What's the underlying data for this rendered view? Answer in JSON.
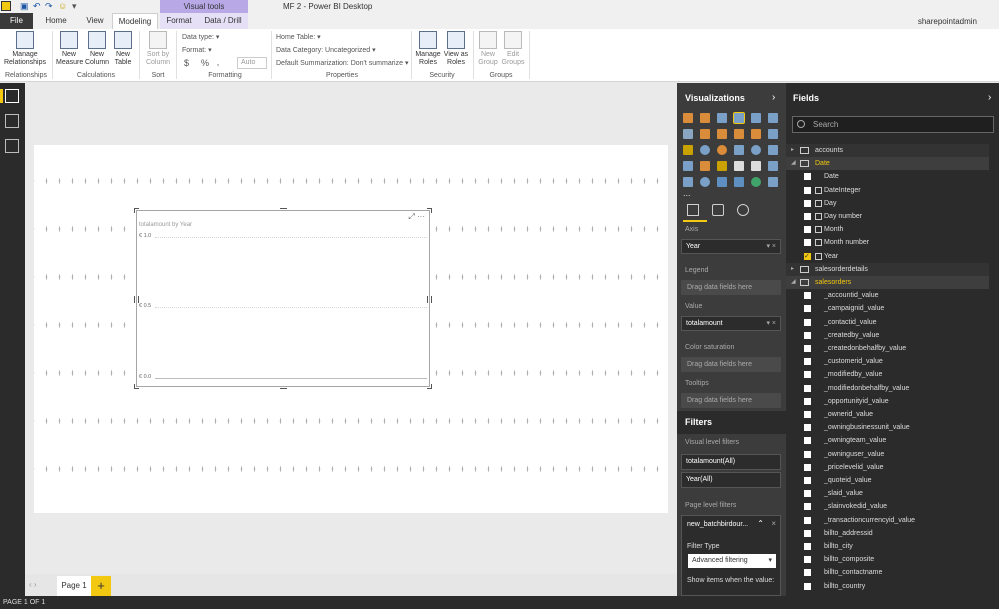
{
  "window": {
    "title": "MF 2 - Power BI Desktop",
    "context_tab_group": "Visual tools",
    "user": "sharepointadmin"
  },
  "tabs": {
    "file": "File",
    "home": "Home",
    "view": "View",
    "modeling": "Modeling",
    "format": "Format",
    "data_drill": "Data / Drill"
  },
  "ribbon": {
    "manage_relationships": "Manage\nRelationships",
    "new_measure": "New\nMeasure",
    "new_column": "New\nColumn",
    "new_table": "New\nTable",
    "sort_by_column": "Sort by\nColumn",
    "data_type": "Data type:",
    "format": "Format:",
    "currency": "$",
    "percent": "%",
    "comma": "‚",
    "auto": "Auto",
    "home_table": "Home Table:",
    "data_category": "Data Category: Uncategorized",
    "default_summarization": "Default Summarization: Don't summarize",
    "manage_roles": "Manage\nRoles",
    "view_as_roles": "View as\nRoles",
    "new_group": "New\nGroup",
    "edit_groups": "Edit\nGroups",
    "groups": {
      "relationships": "Relationships",
      "calculations": "Calculations",
      "sort": "Sort",
      "formatting": "Formatting",
      "properties": "Properties",
      "security": "Security",
      "groups": "Groups"
    }
  },
  "visual": {
    "title": "totalamount by Year",
    "ticks": [
      "€ 1.0",
      "€ 0.5",
      "€ 0.0"
    ]
  },
  "pages": {
    "page1": "Page 1",
    "add": "+"
  },
  "status": "PAGE 1 OF 1",
  "visualizations": {
    "title": "Visualizations",
    "more": "...",
    "axis_label": "Axis",
    "axis_field": "Year",
    "legend_label": "Legend",
    "legend_drop": "Drag data fields here",
    "value_label": "Value",
    "value_field": "totalamount",
    "colorsat_label": "Color saturation",
    "colorsat_drop": "Drag data fields here",
    "tooltips_label": "Tooltips",
    "tooltips_drop": "Drag data fields here"
  },
  "filters": {
    "title": "Filters",
    "visual_level": "Visual level filters",
    "visual_items": [
      "totalamount(All)",
      "Year(All)"
    ],
    "page_level": "Page level filters",
    "page_item": "new_batchbirdour...",
    "filter_type_label": "Filter Type",
    "filter_type": "Advanced filtering",
    "show_items": "Show items when the value:"
  },
  "fields": {
    "title": "Fields",
    "search_placeholder": "Search",
    "rows": [
      {
        "kind": "table",
        "name": "accounts",
        "expanded": false
      },
      {
        "kind": "table",
        "name": "Date",
        "expanded": true
      },
      {
        "kind": "field",
        "name": "Date",
        "icon": false,
        "checked": false
      },
      {
        "kind": "field",
        "name": "DateInteger",
        "icon": true,
        "checked": false
      },
      {
        "kind": "field",
        "name": "Day",
        "icon": true,
        "checked": false
      },
      {
        "kind": "field",
        "name": "Day number",
        "icon": true,
        "checked": false
      },
      {
        "kind": "field",
        "name": "Month",
        "icon": true,
        "checked": false
      },
      {
        "kind": "field",
        "name": "Month number",
        "icon": true,
        "checked": false
      },
      {
        "kind": "field",
        "name": "Year",
        "icon": true,
        "checked": true
      },
      {
        "kind": "table",
        "name": "salesorderdetails",
        "expanded": false
      },
      {
        "kind": "table",
        "name": "salesorders",
        "expanded": true
      },
      {
        "kind": "field",
        "name": "_accountid_value",
        "icon": false,
        "checked": false
      },
      {
        "kind": "field",
        "name": "_campaignid_value",
        "icon": false,
        "checked": false
      },
      {
        "kind": "field",
        "name": "_contactid_value",
        "icon": false,
        "checked": false
      },
      {
        "kind": "field",
        "name": "_createdby_value",
        "icon": false,
        "checked": false
      },
      {
        "kind": "field",
        "name": "_createdonbehalfby_value",
        "icon": false,
        "checked": false
      },
      {
        "kind": "field",
        "name": "_customerid_value",
        "icon": false,
        "checked": false
      },
      {
        "kind": "field",
        "name": "_modifiedby_value",
        "icon": false,
        "checked": false
      },
      {
        "kind": "field",
        "name": "_modifiedonbehalfby_value",
        "icon": false,
        "checked": false
      },
      {
        "kind": "field",
        "name": "_opportunityid_value",
        "icon": false,
        "checked": false
      },
      {
        "kind": "field",
        "name": "_ownerid_value",
        "icon": false,
        "checked": false
      },
      {
        "kind": "field",
        "name": "_owningbusinessunit_value",
        "icon": false,
        "checked": false
      },
      {
        "kind": "field",
        "name": "_owningteam_value",
        "icon": false,
        "checked": false
      },
      {
        "kind": "field",
        "name": "_owninguser_value",
        "icon": false,
        "checked": false
      },
      {
        "kind": "field",
        "name": "_pricelevelid_value",
        "icon": false,
        "checked": false
      },
      {
        "kind": "field",
        "name": "_quoteid_value",
        "icon": false,
        "checked": false
      },
      {
        "kind": "field",
        "name": "_slaid_value",
        "icon": false,
        "checked": false
      },
      {
        "kind": "field",
        "name": "_slainvokedid_value",
        "icon": false,
        "checked": false
      },
      {
        "kind": "field",
        "name": "_transactioncurrencyid_value",
        "icon": false,
        "checked": false
      },
      {
        "kind": "field",
        "name": "billto_addressid",
        "icon": false,
        "checked": false
      },
      {
        "kind": "field",
        "name": "billto_city",
        "icon": false,
        "checked": false
      },
      {
        "kind": "field",
        "name": "billto_composite",
        "icon": false,
        "checked": false
      },
      {
        "kind": "field",
        "name": "billto_contactname",
        "icon": false,
        "checked": false
      },
      {
        "kind": "field",
        "name": "billto_country",
        "icon": false,
        "checked": false
      }
    ]
  }
}
